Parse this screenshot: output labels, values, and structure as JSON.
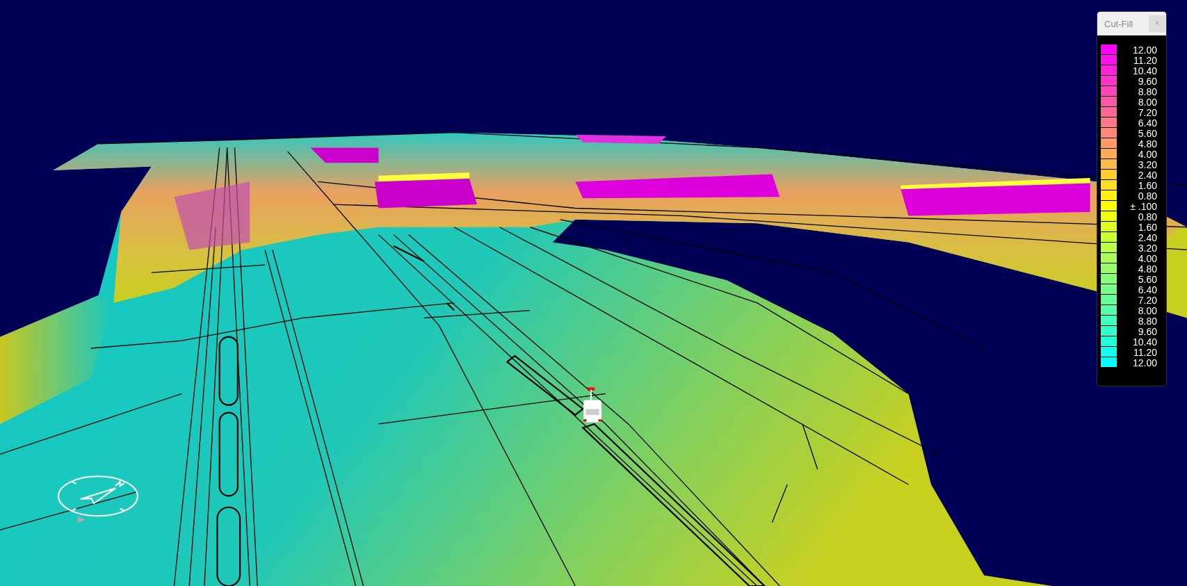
{
  "legend": {
    "title": "Cut-Fill",
    "close": "×",
    "entries": [
      {
        "label": "12.00",
        "color": "#ff00ff"
      },
      {
        "label": "11.20",
        "color": "#ff11ee"
      },
      {
        "label": "10.40",
        "color": "#ff22dd"
      },
      {
        "label": "9.60",
        "color": "#ff33cc"
      },
      {
        "label": "8.80",
        "color": "#ff44bb"
      },
      {
        "label": "8.00",
        "color": "#ff55aa"
      },
      {
        "label": "7.20",
        "color": "#ff6699"
      },
      {
        "label": "6.40",
        "color": "#ff7788"
      },
      {
        "label": "5.60",
        "color": "#ff8877"
      },
      {
        "label": "4.80",
        "color": "#ff9966"
      },
      {
        "label": "4.00",
        "color": "#ffaa55"
      },
      {
        "label": "3.20",
        "color": "#ffbb44"
      },
      {
        "label": "2.40",
        "color": "#ffcc33"
      },
      {
        "label": "1.60",
        "color": "#ffdd22"
      },
      {
        "label": "0.80",
        "color": "#ffee11"
      },
      {
        "label": "± .100",
        "color": "#ffff00"
      },
      {
        "label": "0.80",
        "color": "#eeff11"
      },
      {
        "label": "1.60",
        "color": "#ddff22"
      },
      {
        "label": "2.40",
        "color": "#ccff33"
      },
      {
        "label": "3.20",
        "color": "#bbff44"
      },
      {
        "label": "4.00",
        "color": "#aaff55"
      },
      {
        "label": "4.80",
        "color": "#99ff66"
      },
      {
        "label": "5.60",
        "color": "#88ff77"
      },
      {
        "label": "6.40",
        "color": "#77ff88"
      },
      {
        "label": "7.20",
        "color": "#66ff99"
      },
      {
        "label": "8.00",
        "color": "#55ffaa"
      },
      {
        "label": "8.80",
        "color": "#44ffbb"
      },
      {
        "label": "9.60",
        "color": "#33ffcc"
      },
      {
        "label": "10.40",
        "color": "#22ffdd"
      },
      {
        "label": "11.20",
        "color": "#11ffee"
      },
      {
        "label": "12.00",
        "color": "#00ffff"
      }
    ]
  }
}
